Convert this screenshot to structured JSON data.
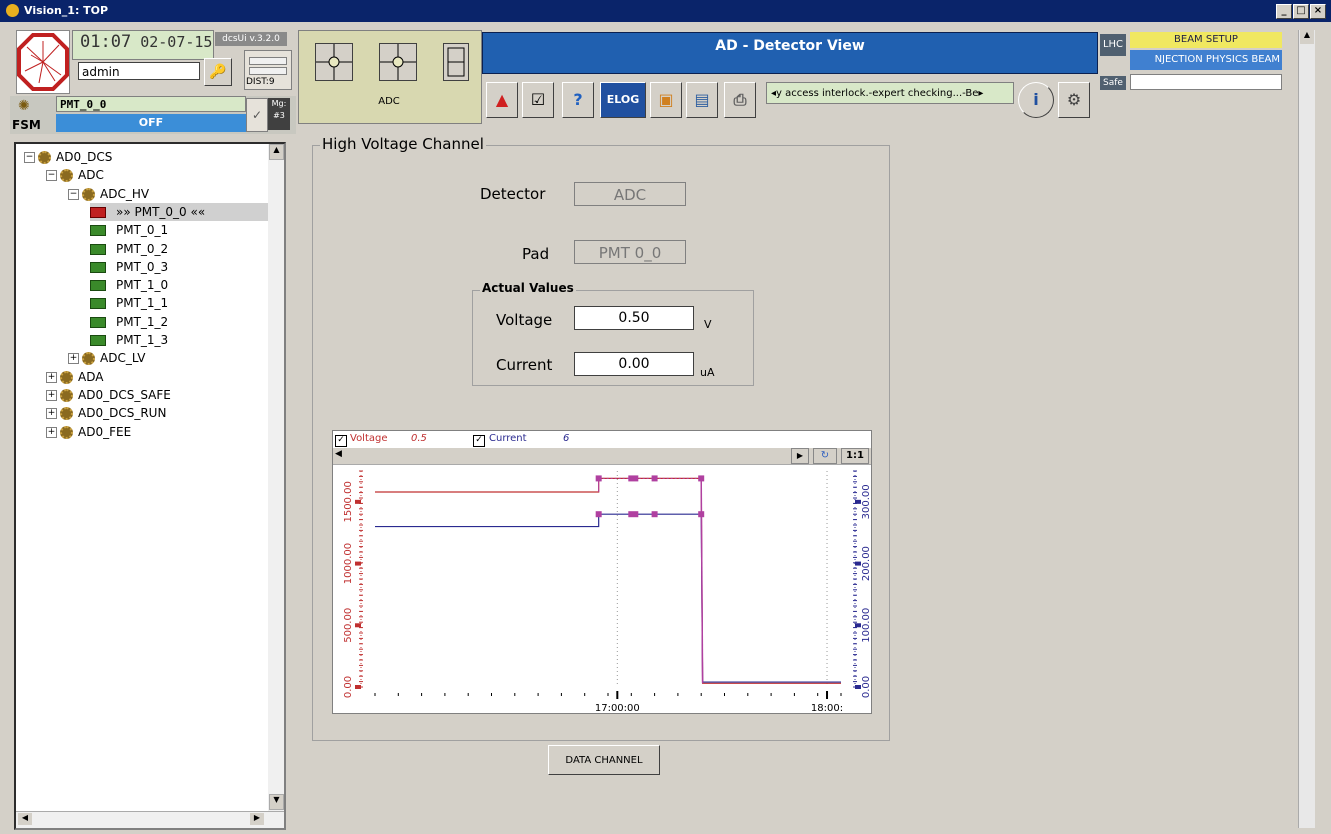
{
  "window": {
    "title": "Vision_1: TOP",
    "controls": [
      "_",
      "□",
      "×"
    ]
  },
  "header": {
    "time": "01:07",
    "date": "02-07-15",
    "version": "dcsUi v.3.2.0",
    "user": "admin",
    "dist": "DIST:9"
  },
  "fsm": {
    "label": "FSM",
    "node": "PMT_0_0",
    "state": "OFF",
    "mgr": "Mg: #3"
  },
  "tree": {
    "items": [
      {
        "label": "AD0_DCS",
        "level": 0,
        "kind": "gear",
        "exp": "−"
      },
      {
        "label": "ADC",
        "level": 1,
        "kind": "gear",
        "exp": "−"
      },
      {
        "label": "ADC_HV",
        "level": 2,
        "kind": "gear",
        "exp": "−"
      },
      {
        "label": "»» PMT_0_0 ««",
        "level": 3,
        "kind": "pmt",
        "selected": true
      },
      {
        "label": "PMT_0_1",
        "level": 3,
        "kind": "pmt"
      },
      {
        "label": "PMT_0_2",
        "level": 3,
        "kind": "pmt"
      },
      {
        "label": "PMT_0_3",
        "level": 3,
        "kind": "pmt"
      },
      {
        "label": "PMT_1_0",
        "level": 3,
        "kind": "pmt"
      },
      {
        "label": "PMT_1_1",
        "level": 3,
        "kind": "pmt"
      },
      {
        "label": "PMT_1_2",
        "level": 3,
        "kind": "pmt"
      },
      {
        "label": "PMT_1_3",
        "level": 3,
        "kind": "pmt"
      },
      {
        "label": "ADC_LV",
        "level": 2,
        "kind": "gear",
        "exp": "+"
      },
      {
        "label": "ADA",
        "level": 1,
        "kind": "gear",
        "exp": "+"
      },
      {
        "label": "AD0_DCS_SAFE",
        "level": 1,
        "kind": "gear",
        "exp": "+"
      },
      {
        "label": "AD0_DCS_RUN",
        "level": 1,
        "kind": "gear",
        "exp": "+"
      },
      {
        "label": "AD0_FEE",
        "level": 1,
        "kind": "gear",
        "exp": "+"
      }
    ]
  },
  "device": {
    "label": "ADC"
  },
  "view": {
    "title": "AD - Detector View"
  },
  "toolbar": {
    "elog": "ELOG",
    "ticker": "◂y access interlock.-expert checking...-Be▸"
  },
  "lhc": {
    "lhc_label": "LHC",
    "safe_label": "Safe",
    "beam_setup": "BEAM SETUP",
    "beam_mode": "NJECTION PHYSICS BEAM"
  },
  "panel": {
    "group_title": "High Voltage Channel",
    "detector_label": "Detector",
    "detector_value": "ADC",
    "pad_label": "Pad",
    "pad_value": "PMT 0_0",
    "actual_title": "Actual Values",
    "voltage_label": "Voltage",
    "voltage_value": "0.50",
    "voltage_unit": "V",
    "current_label": "Current",
    "current_value": "0.00",
    "current_unit": "uA",
    "data_channel": "DATA CHANNEL"
  },
  "legend": {
    "voltage_name": "Voltage",
    "voltage_value": "0.5",
    "current_name": "Current",
    "current_value": "6"
  },
  "chart_toolbar": {
    "zoom_label": "1:1"
  },
  "chart_data": {
    "type": "line",
    "xlabel": "",
    "ylabel": "",
    "x_ticks": [
      "17:00:00",
      "18:00:"
    ],
    "left_ticks": [
      "0.00",
      "500.00",
      "1000.00",
      "1500.00"
    ],
    "right_ticks": [
      "0.00",
      "100.00",
      "200.00",
      "300.00"
    ],
    "ylim_left": [
      0,
      1750
    ],
    "ylim_right": [
      0,
      350
    ],
    "xlim": [
      0,
      100
    ],
    "series": [
      {
        "name": "Voltage",
        "color": "#c03030",
        "axis": "left",
        "x": [
          0,
          48,
          48,
          70,
          70,
          70.3,
          100
        ],
        "y": [
          1580,
          1580,
          1690,
          1690,
          1690,
          30,
          30
        ]
      },
      {
        "name": "Current",
        "color": "#2a2a90",
        "axis": "right",
        "x": [
          0,
          48,
          48,
          70,
          70,
          70.3,
          100
        ],
        "y": [
          260,
          260,
          280,
          280,
          280,
          8,
          8
        ]
      }
    ],
    "markers": {
      "color": "#b040a0",
      "voltage_x": [
        48,
        55,
        60,
        70
      ],
      "current_x": [
        48,
        55,
        60,
        70
      ]
    }
  }
}
